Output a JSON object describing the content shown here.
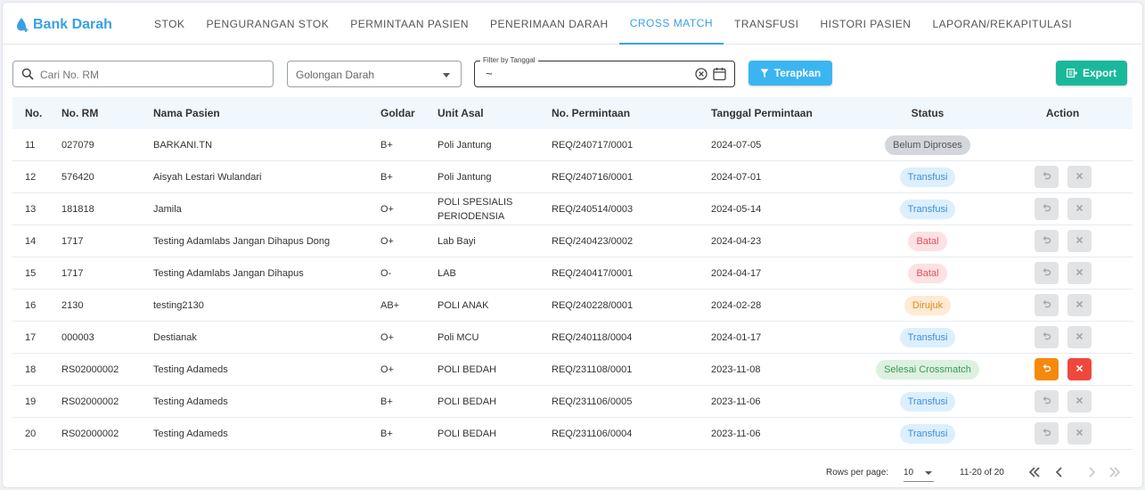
{
  "app": {
    "title": "Bank Darah",
    "logo_icon": "blood-drop-icon"
  },
  "tabs": [
    {
      "label": "STOK"
    },
    {
      "label": "PENGURANGAN STOK"
    },
    {
      "label": "PERMINTAAN PASIEN"
    },
    {
      "label": "PENERIMAAN DARAH"
    },
    {
      "label": "CROSS MATCH",
      "active": true
    },
    {
      "label": "TRANSFUSI"
    },
    {
      "label": "HISTORI PASIEN"
    },
    {
      "label": "LAPORAN/REKAPITULASI"
    }
  ],
  "filters": {
    "search_placeholder": "Cari No. RM",
    "golongan_placeholder": "Golongan Darah",
    "date_label": "Filter by Tanggal",
    "date_value": "~",
    "apply_label": "Terapkan",
    "export_label": "Export"
  },
  "table": {
    "headers": {
      "no": "No.",
      "rm": "No. RM",
      "nama": "Nama Pasien",
      "goldar": "Goldar",
      "unit": "Unit Asal",
      "req": "No. Permintaan",
      "tgl": "Tanggal Permintaan",
      "status": "Status",
      "action": "Action"
    },
    "rows": [
      {
        "no": "11",
        "rm": "027079",
        "nama": "BARKANI.TN",
        "goldar": "B+",
        "unit": "Poli Jantung",
        "req": "REQ/240717/0001",
        "tgl": "2024-07-05",
        "status": "Belum Diproses",
        "status_type": "grey",
        "actions": false
      },
      {
        "no": "12",
        "rm": "576420",
        "nama": "Aisyah Lestari Wulandari",
        "goldar": "B+",
        "unit": "Poli Jantung",
        "req": "REQ/240716/0001",
        "tgl": "2024-07-01",
        "status": "Transfusi",
        "status_type": "blue",
        "actions": true,
        "actions_enabled": false
      },
      {
        "no": "13",
        "rm": "181818",
        "nama": "Jamila",
        "goldar": "O+",
        "unit": "POLI SPESIALIS PERIODENSIA",
        "req": "REQ/240514/0003",
        "tgl": "2024-05-14",
        "status": "Transfusi",
        "status_type": "blue",
        "actions": true,
        "actions_enabled": false
      },
      {
        "no": "14",
        "rm": "1717",
        "nama": "Testing Adamlabs Jangan Dihapus Dong",
        "goldar": "O+",
        "unit": "Lab Bayi",
        "req": "REQ/240423/0002",
        "tgl": "2024-04-23",
        "status": "Batal",
        "status_type": "red",
        "actions": true,
        "actions_enabled": false
      },
      {
        "no": "15",
        "rm": "1717",
        "nama": "Testing Adamlabs Jangan Dihapus",
        "goldar": "O-",
        "unit": "LAB",
        "req": "REQ/240417/0001",
        "tgl": "2024-04-17",
        "status": "Batal",
        "status_type": "red",
        "actions": true,
        "actions_enabled": false
      },
      {
        "no": "16",
        "rm": "2130",
        "nama": "testing2130",
        "goldar": "AB+",
        "unit": "POLI ANAK",
        "req": "REQ/240228/0001",
        "tgl": "2024-02-28",
        "status": "Dirujuk",
        "status_type": "orange",
        "actions": true,
        "actions_enabled": false
      },
      {
        "no": "17",
        "rm": "000003",
        "nama": "Destianak",
        "goldar": "O+",
        "unit": "Poli MCU",
        "req": "REQ/240118/0004",
        "tgl": "2024-01-17",
        "status": "Transfusi",
        "status_type": "blue",
        "actions": true,
        "actions_enabled": false
      },
      {
        "no": "18",
        "rm": "RS02000002",
        "nama": "Testing Adameds",
        "goldar": "O+",
        "unit": "POLI BEDAH",
        "req": "REQ/231108/0001",
        "tgl": "2023-11-08",
        "status": "Selesai Crossmatch",
        "status_type": "green",
        "actions": true,
        "actions_enabled": true
      },
      {
        "no": "19",
        "rm": "RS02000002",
        "nama": "Testing Adameds",
        "goldar": "B+",
        "unit": "POLI BEDAH",
        "req": "REQ/231106/0005",
        "tgl": "2023-11-06",
        "status": "Transfusi",
        "status_type": "blue",
        "actions": true,
        "actions_enabled": false
      },
      {
        "no": "20",
        "rm": "RS02000002",
        "nama": "Testing Adameds",
        "goldar": "B+",
        "unit": "POLI BEDAH",
        "req": "REQ/231106/0004",
        "tgl": "2023-11-06",
        "status": "Transfusi",
        "status_type": "blue",
        "actions": true,
        "actions_enabled": false
      }
    ]
  },
  "pagination": {
    "rows_per_page_label": "Rows per page:",
    "rows_per_page": "10",
    "range": "11-20 of 20"
  },
  "colors": {
    "primary": "#3aa0e4",
    "apply": "#3ab5f2",
    "export": "#1ab89a",
    "undo_active": "#f5890d",
    "delete_active": "#f0473d"
  }
}
